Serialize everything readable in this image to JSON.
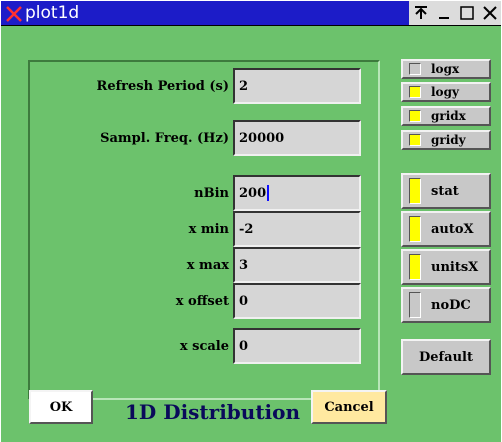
{
  "window": {
    "title": "plot1d",
    "titlebar_color": "#1c1cc8",
    "app_icon": "x-close-icon",
    "controls": [
      {
        "name": "always-on-top-icon",
        "glyph": "⊼"
      },
      {
        "name": "minimize-icon",
        "glyph": "_"
      },
      {
        "name": "maximize-icon",
        "glyph": "□"
      },
      {
        "name": "close-icon",
        "glyph": "✕"
      }
    ]
  },
  "form": {
    "refresh_period": {
      "label": "Refresh Period (s)",
      "value": "2"
    },
    "sampl_freq": {
      "label": "Sampl. Freq. (Hz)",
      "value": "20000"
    },
    "nbin": {
      "label": "nBin",
      "value": "200"
    },
    "xmin": {
      "label": "x min",
      "value": "-2"
    },
    "xmax": {
      "label": "x max",
      "value": "3"
    },
    "xoffset": {
      "label": "x offset",
      "value": "0"
    },
    "xscale": {
      "label": "x scale",
      "value": "0"
    }
  },
  "toggles": {
    "logx": {
      "label": "logx",
      "on": false
    },
    "logy": {
      "label": "logy",
      "on": true
    },
    "gridx": {
      "label": "gridx",
      "on": true
    },
    "gridy": {
      "label": "gridy",
      "on": true
    },
    "stat": {
      "label": "stat",
      "on": true
    },
    "autox": {
      "label": "autoX",
      "on": true
    },
    "unitsx": {
      "label": "unitsX",
      "on": true
    },
    "nodc": {
      "label": "noDC",
      "on": false
    }
  },
  "buttons": {
    "default_label": "Default",
    "ok_label": "OK",
    "cancel_label": "Cancel"
  },
  "footer": {
    "title": "1D Distribution"
  },
  "colors": {
    "background": "#6cc26c",
    "field_bg": "#d6d6d6",
    "led_on": "#ffff00",
    "button_bg": "#c8c8c8",
    "ok_bg": "#ffffff",
    "cancel_bg": "#ffe9a0",
    "footer_text": "#0a0a5a"
  }
}
